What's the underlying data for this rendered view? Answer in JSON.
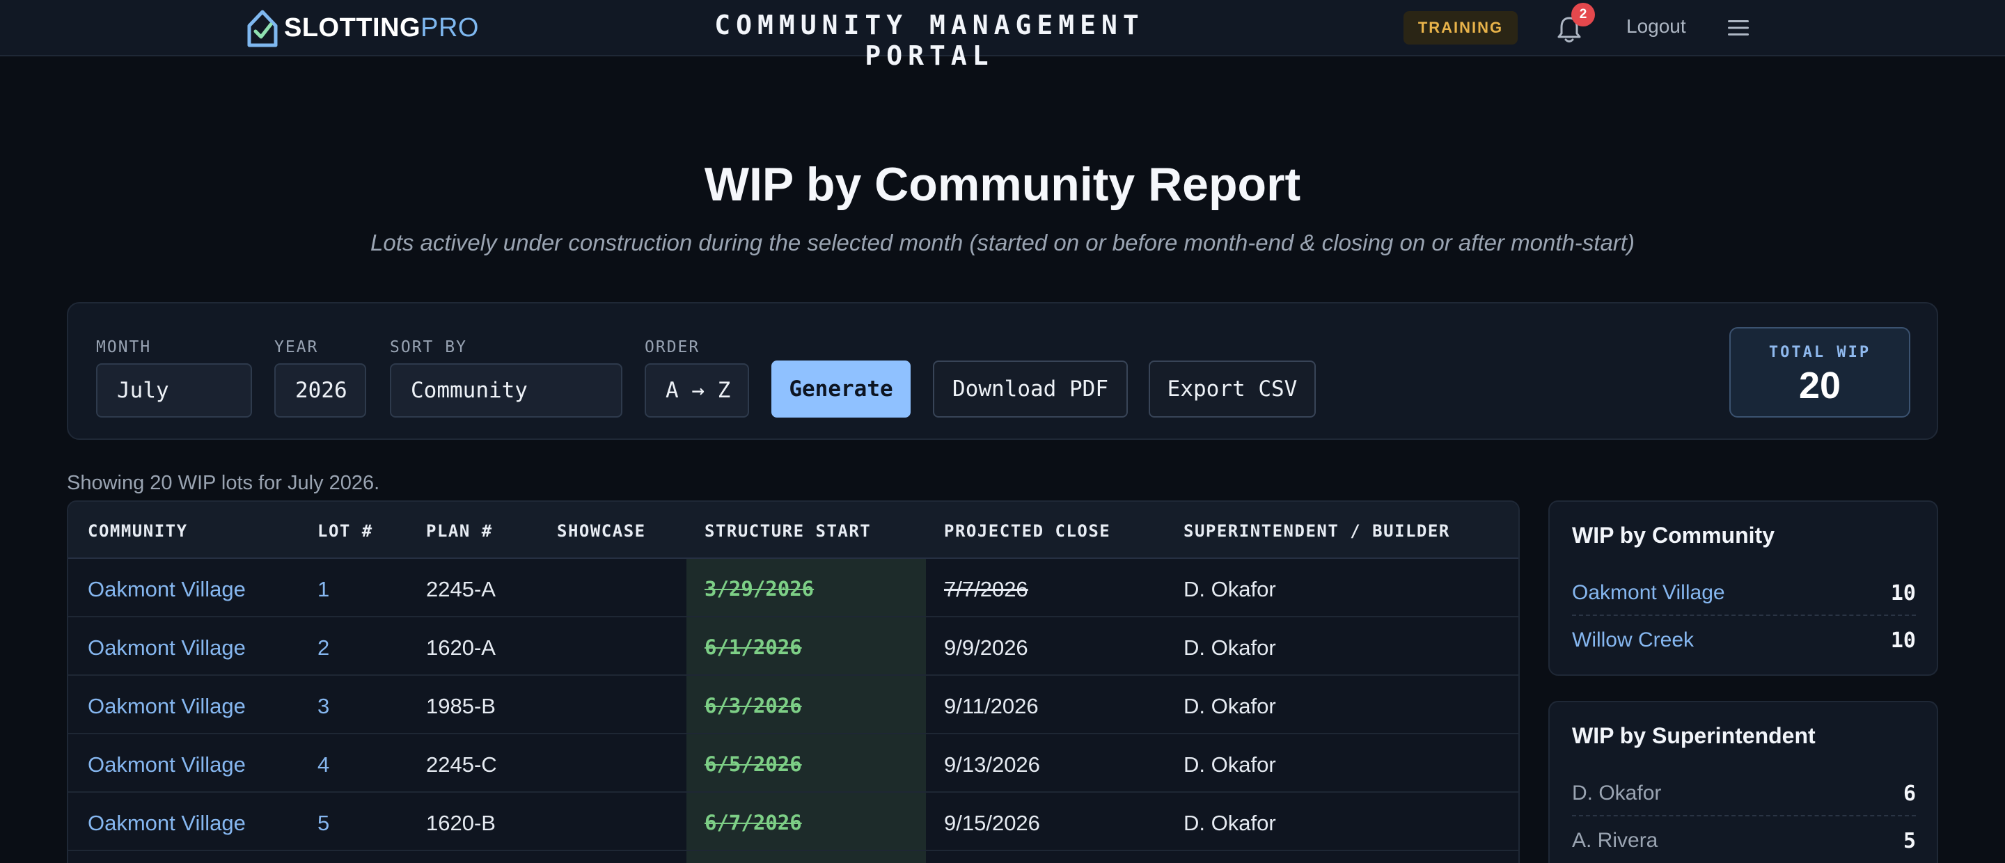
{
  "nav": {
    "brand_slot": "SLOTTING",
    "brand_pro": "PRO",
    "portal_title": "COMMUNITY MANAGEMENT PORTAL",
    "training_badge": "TRAINING",
    "notification_count": "2",
    "logout_label": "Logout"
  },
  "header": {
    "title": "WIP by Community Report",
    "subtitle": "Lots actively under construction during the selected month (started on or before month-end & closing on or after month-start)"
  },
  "controls": {
    "month_label": "MONTH",
    "month_value": "July",
    "year_label": "YEAR",
    "year_value": "2026",
    "sort_label": "SORT BY",
    "sort_value": "Community",
    "order_label": "ORDER",
    "order_value": "A → Z",
    "generate_label": "Generate",
    "download_pdf_label": "Download PDF",
    "export_csv_label": "Export CSV",
    "total_wip_label": "TOTAL WIP",
    "total_wip_value": "20"
  },
  "showing_text": "Showing 20 WIP lots for July 2026.",
  "table": {
    "columns": [
      "COMMUNITY",
      "LOT #",
      "PLAN #",
      "SHOWCASE",
      "STRUCTURE START",
      "PROJECTED CLOSE",
      "SUPERINTENDENT / BUILDER"
    ],
    "rows": [
      {
        "community": "Oakmont Village",
        "lot": "1",
        "plan": "2245-A",
        "showcase": "",
        "start": "3/29/2026",
        "close": "7/7/2026",
        "close_struck": true,
        "super": "D. Okafor"
      },
      {
        "community": "Oakmont Village",
        "lot": "2",
        "plan": "1620-A",
        "showcase": "",
        "start": "6/1/2026",
        "close": "9/9/2026",
        "close_struck": false,
        "super": "D. Okafor"
      },
      {
        "community": "Oakmont Village",
        "lot": "3",
        "plan": "1985-B",
        "showcase": "",
        "start": "6/3/2026",
        "close": "9/11/2026",
        "close_struck": false,
        "super": "D. Okafor"
      },
      {
        "community": "Oakmont Village",
        "lot": "4",
        "plan": "2245-C",
        "showcase": "",
        "start": "6/5/2026",
        "close": "9/13/2026",
        "close_struck": false,
        "super": "D. Okafor"
      },
      {
        "community": "Oakmont Village",
        "lot": "5",
        "plan": "1620-B",
        "showcase": "",
        "start": "6/7/2026",
        "close": "9/15/2026",
        "close_struck": false,
        "super": "D. Okafor"
      }
    ]
  },
  "by_community": {
    "title": "WIP by Community",
    "items": [
      {
        "name": "Oakmont Village",
        "count": "10"
      },
      {
        "name": "Willow Creek",
        "count": "10"
      }
    ]
  },
  "by_superintendent": {
    "title": "WIP by Superintendent",
    "items": [
      {
        "name": "D. Okafor",
        "count": "6"
      },
      {
        "name": "A. Rivera",
        "count": "5"
      }
    ]
  },
  "colors": {
    "accent": "#8fc1ff",
    "link": "#86b7f0",
    "training": "#e8b34a",
    "badge_red": "#e5484d",
    "start_green": "#7dcf86"
  }
}
